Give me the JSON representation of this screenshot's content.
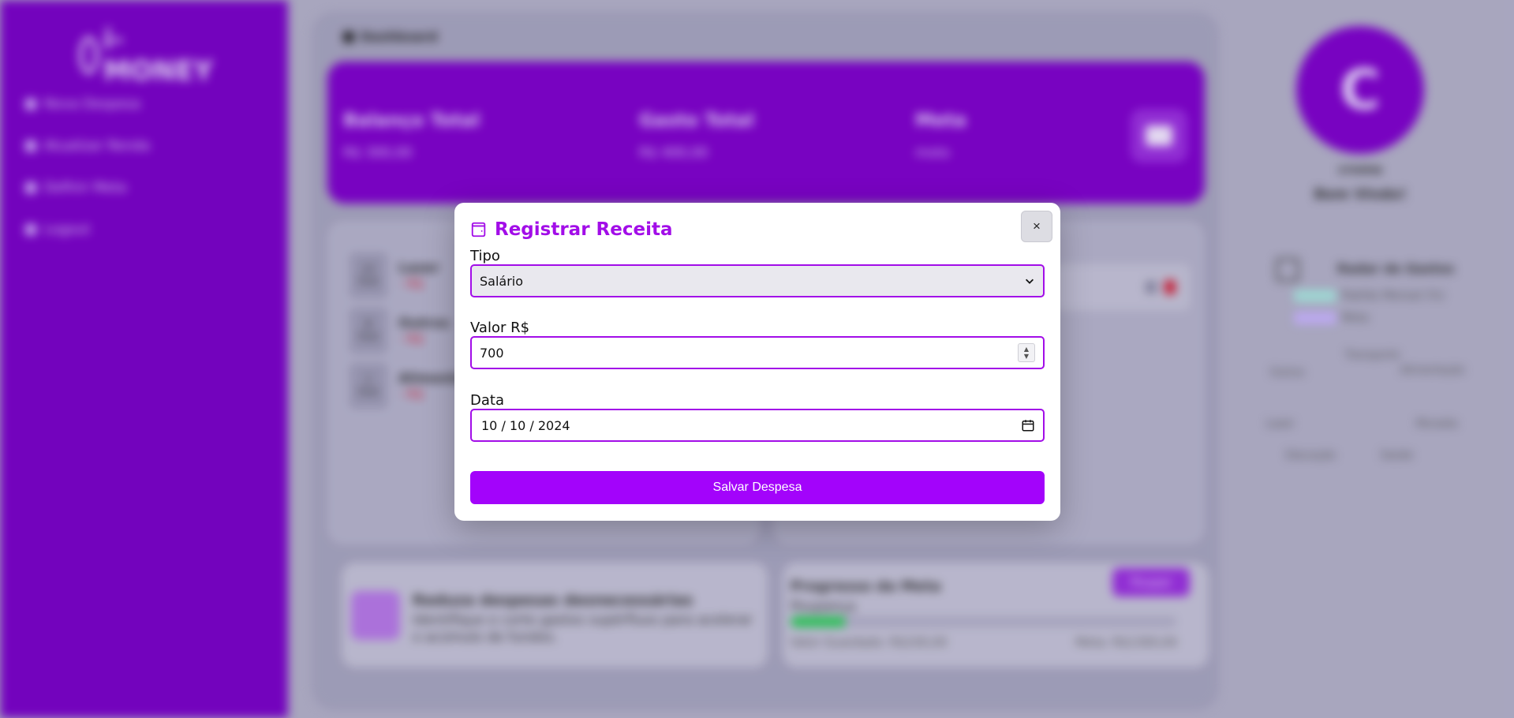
{
  "app": {
    "brand": "i-MONEY",
    "nav": [
      {
        "label": "Nova Despesa"
      },
      {
        "label": "Atualizar Renda"
      },
      {
        "label": "Definir Meta"
      },
      {
        "label": "Logout"
      }
    ]
  },
  "dashboard": {
    "breadcrumb": "Dashboard",
    "stats": {
      "balance_label": "Balanço Total",
      "balance_value": "R$ 300,00",
      "spent_label": "Gasto Total",
      "spent_value": "R$ 400,00",
      "goal_label": "Meta",
      "goal_value": "moto"
    },
    "transactions": [
      {
        "day": "12",
        "month": "Out",
        "title": "Lazer",
        "value": "- R$"
      },
      {
        "day": "8",
        "month": "Out",
        "title": "Outros",
        "value": "- R$"
      },
      {
        "day": "1",
        "month": "Out",
        "title": "Alimentação",
        "value": "- R$"
      }
    ],
    "tip": {
      "title": "Reduza despesas desnecessárias",
      "text": "Identifique e corte gastos supérfluos para acelerar o acúmulo de fundos."
    },
    "goal_progress": {
      "title": "Progresso da Meta",
      "button": "Poupar",
      "name": "Poupança",
      "progress": 0.14,
      "saved": "Valor Guardado: R$100,00",
      "target": "Meta: R$1300,00"
    }
  },
  "profile": {
    "initial": "C",
    "name": "croma",
    "welcome": "Bem Vindo!",
    "radar": {
      "title": "Radar de Gastos",
      "legend": [
        "Padrão Mensal (%)",
        "Meta"
      ],
      "labels": [
        "Transporte",
        "Saúde",
        "Educação",
        "Lazer",
        "Moradia",
        "Alimentação",
        "Outros"
      ]
    }
  },
  "modal": {
    "title": "Registrar Receita",
    "close_label": "×",
    "tipo_label": "Tipo",
    "tipo_value": "Salário",
    "valor_label": "Valor R$",
    "valor_value": "700",
    "data_label": "Data",
    "data_value": "10 / 10 / 2024",
    "save_label": "Salvar Despesa"
  },
  "colors": {
    "sidebar": "#7a00c8",
    "accent": "#a20de8",
    "button": "#a303fb"
  }
}
